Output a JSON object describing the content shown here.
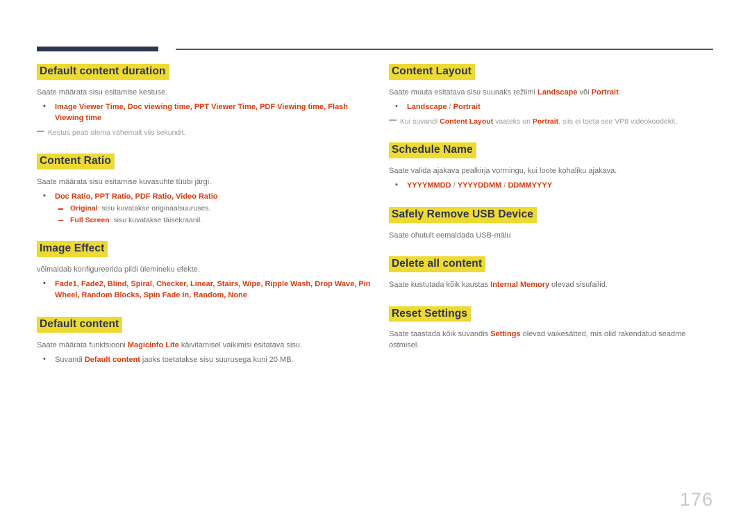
{
  "document": {
    "page_number": "176",
    "accent_yellow": "#edda33",
    "accent_red": "#e0380d",
    "heading_navy": "#2e3550",
    "body_gray": "#6e6e6e"
  },
  "left_column": {
    "sections": [
      {
        "heading": "Default content duration",
        "intro": "Saate määrata sisu esitamise kestuse.",
        "bullets": [
          "Image Viewer Time, Doc viewing time, PPT Viewer Time, PDF Viewing time, Flash Viewing time"
        ],
        "note": "Kestus peab olema vähemalt viis sekundit."
      },
      {
        "heading": "Content Ratio",
        "intro": "Saate määrata sisu esitamise kuvasuhte tüübi järgi.",
        "bullets": [
          "Doc Ratio, PPT Ratio, PDF Ratio, Video Ratio"
        ],
        "subbullets": [
          {
            "term": "Original",
            "text": ": sisu kuvatakse originaalsuuruses."
          },
          {
            "term": "Full Screen",
            "text": ": sisu kuvatakse täisekraanil."
          }
        ]
      },
      {
        "heading": "Image Effect",
        "intro": "võimaldab konfigureerida pildi ülemineku efekte.",
        "bullets": [
          "Fade1, Fade2, Blind, Spiral, Checker, Linear, Stairs, Wipe, Ripple Wash, Drop Wave, Pin Wheel, Random Blocks, Spin Fade In, Random, None"
        ]
      },
      {
        "heading": "Default content",
        "intro_pre": "Saate määrata funktsiooni ",
        "intro_term": "MagicInfo Lite",
        "intro_post": " käivitamisel vaikimisi esitatava sisu.",
        "bullet_pre": "Suvandi ",
        "bullet_term": "Default content",
        "bullet_post": " jaoks toetatakse sisu suurusega kuni 20 MB."
      }
    ]
  },
  "right_column": {
    "sections": [
      {
        "heading": "Content Layout",
        "intro_pre": "Saate muuta esitatava sisu suunaks režiimi ",
        "intro_term1": "Landscape",
        "intro_mid": " või ",
        "intro_term2": "Portrait",
        "intro_post": ".",
        "bullet_term1": "Landscape",
        "bullet_sep": " / ",
        "bullet_term2": "Portrait",
        "note_pre": "Kui suvandi ",
        "note_term1": "Content Layout",
        "note_mid": " vaateks on ",
        "note_term2": "Portrait",
        "note_post": ", siis ei toeta see VP8 videokoodekit."
      },
      {
        "heading": "Schedule Name",
        "intro": "Saate valida ajakava pealkirja vormingu, kui loote kohaliku ajakava.",
        "bullet_items": [
          "YYYYMMDD",
          "YYYYDDMM",
          "DDMMYYYY"
        ],
        "bullet_sep": " / "
      },
      {
        "heading": "Safely Remove USB Device",
        "intro": "Saate ohutult eemaldada USB-mälu"
      },
      {
        "heading": "Delete all content",
        "intro_pre": "Saate kustutada kõik kaustas ",
        "intro_term": "Internal Memory",
        "intro_post": " olevad sisufailid."
      },
      {
        "heading": "Reset Settings",
        "intro_pre": "Saate taastada kõik suvandis ",
        "intro_term": "Settings",
        "intro_post": " olevad vaikesätted, mis olid rakendatud seadme ostmisel."
      }
    ]
  }
}
